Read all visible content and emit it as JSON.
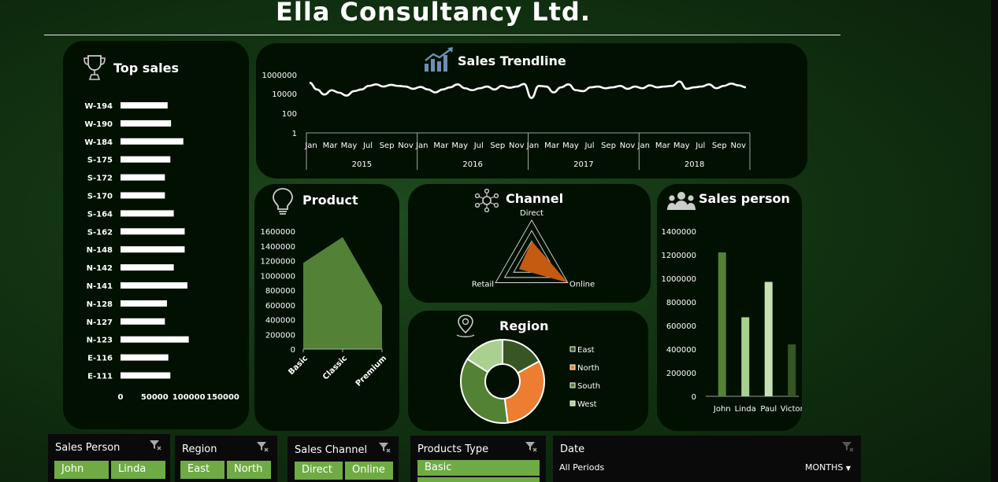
{
  "title": "Ella Consultancy Ltd.",
  "colors": {
    "bar_white": "#ffffff",
    "area_green": "#538135",
    "radar_orange": "#c55a11",
    "east": "#375623",
    "north": "#ed7d31",
    "south": "#548235",
    "west": "#a9d08e",
    "chip": "#6fab44"
  },
  "panels": {
    "top_sales": {
      "title": "Top sales",
      "icon": "trophy-icon"
    },
    "trend": {
      "title": "Sales Trendline",
      "icon": "growth-chart-icon"
    },
    "product": {
      "title": "Product",
      "icon": "lightbulb-icon"
    },
    "channel": {
      "title": "Channel",
      "icon": "network-icon"
    },
    "region": {
      "title": "Region",
      "icon": "location-pin-icon"
    },
    "sales_person": {
      "title": "Sales person",
      "icon": "people-icon"
    }
  },
  "chart_data": [
    {
      "id": "top_sales",
      "type": "bar",
      "orientation": "horizontal",
      "categories": [
        "W-194",
        "W-190",
        "W-184",
        "S-175",
        "S-172",
        "S-170",
        "S-164",
        "S-162",
        "N-148",
        "N-142",
        "N-141",
        "N-128",
        "N-127",
        "N-123",
        "E-116",
        "E-111"
      ],
      "values": [
        69000,
        74000,
        92000,
        73000,
        65000,
        65000,
        78000,
        94000,
        94000,
        78000,
        98000,
        68000,
        65000,
        100000,
        70000,
        73000
      ],
      "xticks": [
        "0",
        "50000",
        "100000",
        "150000"
      ],
      "xlim": [
        0,
        150000
      ]
    },
    {
      "id": "trend",
      "type": "line",
      "scale": "log",
      "yticks": [
        "1000000",
        "10000",
        "100",
        "1"
      ],
      "month_labels": [
        "Jan",
        "Mar",
        "May",
        "Jul",
        "Sep",
        "Nov"
      ],
      "years": [
        "2015",
        "2016",
        "2017",
        "2018"
      ],
      "values": [
        150000,
        30000,
        9000,
        25000,
        14000,
        7000,
        20000,
        30000,
        70000,
        100000,
        60000,
        90000,
        70000,
        60000,
        35000,
        55000,
        30000,
        15000,
        30000,
        50000,
        100000,
        40000,
        25000,
        40000,
        60000,
        30000,
        70000,
        45000,
        60000,
        110000,
        4000,
        70000,
        60000,
        15000,
        50000,
        100000,
        25000,
        20000,
        50000,
        60000,
        40000,
        50000,
        70000,
        35000,
        60000,
        40000,
        80000,
        50000,
        60000,
        70000,
        200000,
        35000,
        50000,
        60000,
        100000,
        40000,
        70000,
        120000,
        80000,
        50000
      ]
    },
    {
      "id": "product",
      "type": "area",
      "categories": [
        "Basic",
        "Classic",
        "Premium"
      ],
      "values": [
        1170000,
        1520000,
        590000
      ],
      "yticks": [
        "1600000",
        "1400000",
        "1200000",
        "1000000",
        "800000",
        "600000",
        "400000",
        "200000",
        "0"
      ],
      "ylim": [
        0,
        1600000
      ]
    },
    {
      "id": "channel",
      "type": "radar",
      "categories": [
        "Direct",
        "Online",
        "Retail"
      ],
      "values": [
        0.5,
        1.0,
        0.35
      ]
    },
    {
      "id": "region",
      "type": "pie",
      "donut": true,
      "labels": [
        "East",
        "North",
        "South",
        "West"
      ],
      "values": [
        17,
        31,
        36,
        16
      ]
    },
    {
      "id": "sales_person",
      "type": "bar",
      "categories": [
        "John",
        "Linda",
        "Paul",
        "Victor"
      ],
      "values": [
        1220000,
        670000,
        970000,
        440000
      ],
      "colors": [
        "#548235",
        "#a9d08e",
        "#c6e0b4",
        "#375623"
      ],
      "yticks": [
        "1400000",
        "1200000",
        "1000000",
        "800000",
        "600000",
        "400000",
        "200000",
        "0"
      ],
      "ylim": [
        0,
        1400000
      ]
    }
  ],
  "slicers": {
    "sales_person": {
      "title": "Sales Person",
      "items": [
        "John",
        "Linda"
      ]
    },
    "region": {
      "title": "Region",
      "items": [
        "East",
        "North"
      ]
    },
    "sales_channel": {
      "title": "Sales Channel",
      "items": [
        "Direct",
        "Online"
      ]
    },
    "products_type": {
      "title": "Products Type",
      "items": [
        "Basic"
      ]
    },
    "date": {
      "title": "Date",
      "period": "All Periods",
      "unit": "MONTHS"
    }
  }
}
